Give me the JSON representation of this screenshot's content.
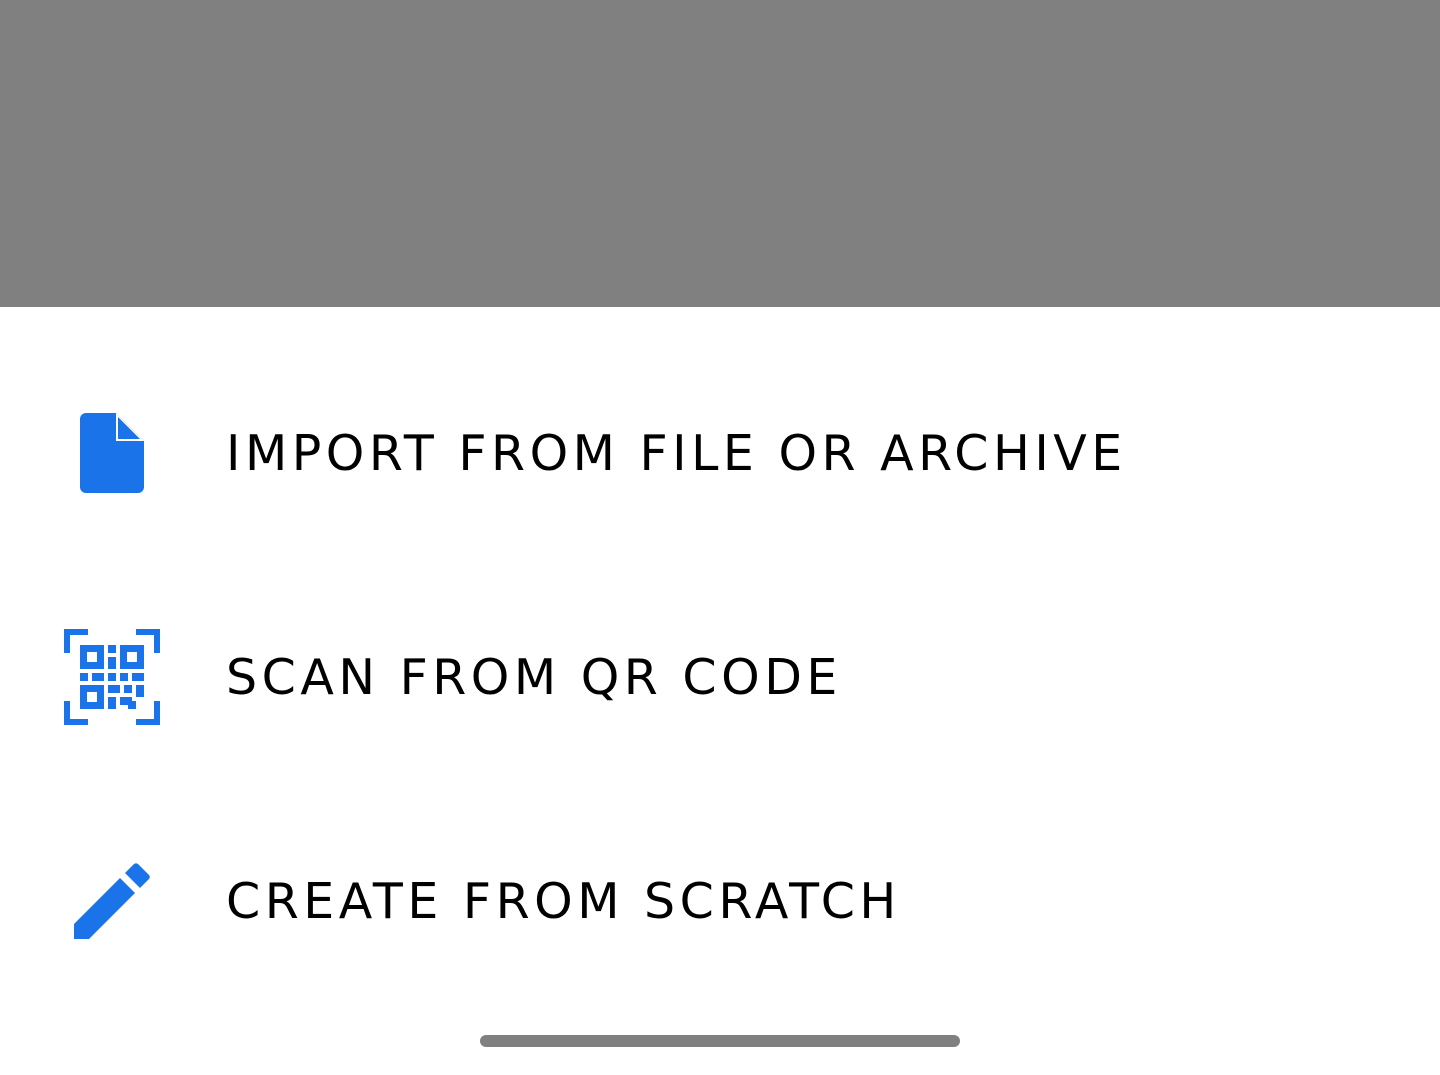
{
  "colors": {
    "accent": "#1a73e8",
    "scrim": "#808080",
    "sheet_background": "#ffffff",
    "text": "#000000"
  },
  "menu": {
    "items": [
      {
        "label": "IMPORT FROM FILE OR ARCHIVE",
        "icon": "file-icon"
      },
      {
        "label": "SCAN FROM QR CODE",
        "icon": "qr-code-scanner-icon"
      },
      {
        "label": "CREATE FROM SCRATCH",
        "icon": "pencil-icon"
      }
    ]
  }
}
